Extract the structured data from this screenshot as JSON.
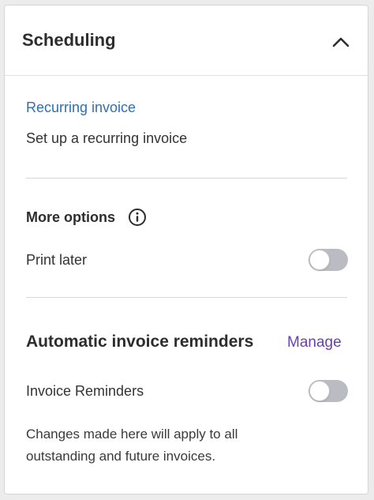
{
  "header": {
    "title": "Scheduling",
    "collapse_icon": "chevron-up-icon"
  },
  "recurring": {
    "link_label": "Recurring invoice",
    "description": "Set up a recurring invoice"
  },
  "more_options": {
    "title": "More options",
    "info_icon": "info-icon",
    "print_later_label": "Print later",
    "print_later_on": false
  },
  "reminders": {
    "title": "Automatic invoice reminders",
    "manage_label": "Manage",
    "invoice_reminders_label": "Invoice Reminders",
    "invoice_reminders_on": false,
    "note": "Changes made here will apply to all outstanding and future invoices."
  },
  "colors": {
    "link": "#2f6fb3",
    "manage": "#6b3fb4",
    "toggle_off": "#b9bcc2"
  }
}
